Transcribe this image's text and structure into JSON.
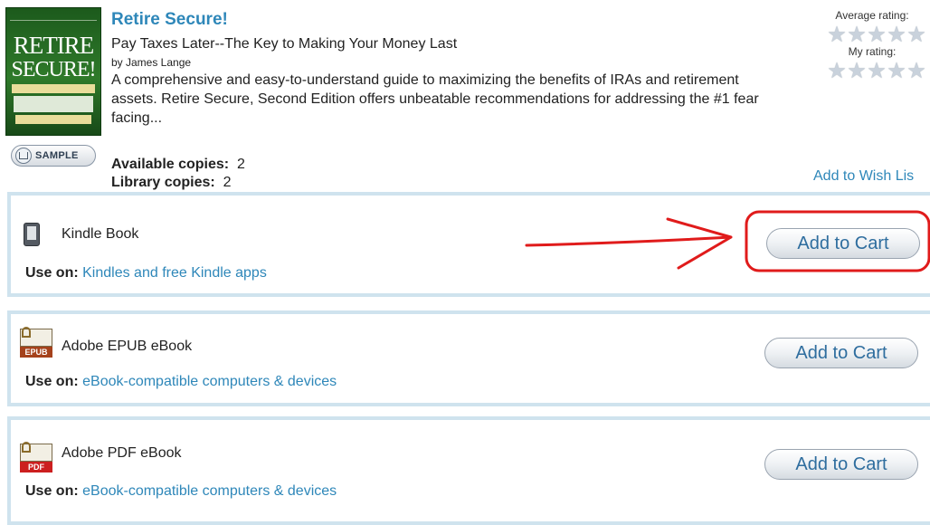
{
  "book": {
    "title": "Retire Secure!",
    "subtitle": "Pay Taxes Later--The Key to Making Your Money Last",
    "author": "by James Lange",
    "description": "A comprehensive and easy-to-understand guide to maximizing the benefits of IRAs and retirement assets. Retire Secure, Second Edition offers unbeatable recommendations for addressing the #1 fear facing...",
    "cover": {
      "line1": "RETIRE",
      "line2": "SECURE!"
    },
    "sample_label": "SAMPLE",
    "available_label": "Available copies:",
    "available_value": "2",
    "library_label": "Library copies:",
    "library_value": "2"
  },
  "ratings": {
    "average_label": "Average rating:",
    "my_label": "My rating:",
    "star_icon": "star-icon"
  },
  "wishlist_label": "Add to Wish Lis",
  "formats": [
    {
      "name": "Kindle Book",
      "use_label": "Use on:",
      "devices": "Kindles and free Kindle apps",
      "button": "Add to Cart",
      "icon": "kindle-icon"
    },
    {
      "name": "Adobe EPUB eBook",
      "use_label": "Use on:",
      "devices": "eBook-compatible computers & devices",
      "button": "Add to Cart",
      "icon": "epub-icon",
      "tag": "EPUB"
    },
    {
      "name": "Adobe PDF eBook",
      "use_label": "Use on:",
      "devices": "eBook-compatible computers & devices",
      "button": "Add to Cart",
      "icon": "pdf-icon",
      "tag": "PDF"
    }
  ],
  "colors": {
    "link": "#2e87b9",
    "annotation": "#e01b1b",
    "row_border": "#cfe3ee"
  }
}
